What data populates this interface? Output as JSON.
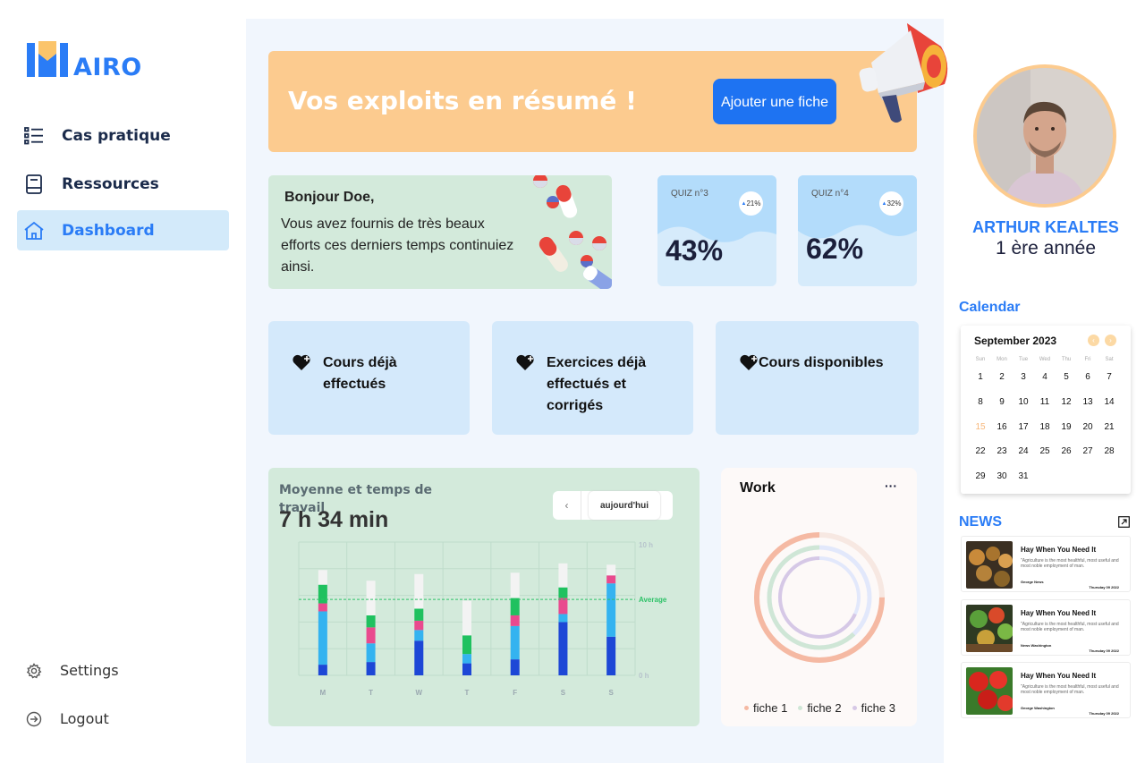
{
  "brand": {
    "name": "AIRO",
    "color": "#2a7cf6"
  },
  "nav": {
    "items": [
      {
        "label": "Cas pratique",
        "icon": "list-icon"
      },
      {
        "label": "Ressources",
        "icon": "book-icon"
      },
      {
        "label": "Dashboard",
        "icon": "home-icon",
        "active": true
      }
    ],
    "bottom": [
      {
        "label": "Settings",
        "icon": "gear-icon"
      },
      {
        "label": "Logout",
        "icon": "logout-icon"
      }
    ]
  },
  "banner": {
    "title": "Vos exploits en résumé  !",
    "button": "Ajouter une fiche"
  },
  "greeting": {
    "title": "Bonjour Doe,",
    "text": "Vous avez fournis de très beaux efforts ces derniers temps continuiez ainsi."
  },
  "quizzes": [
    {
      "label": "QUIZ n°3",
      "change": "21%",
      "value": "43%"
    },
    {
      "label": "QUIZ n°4",
      "change": "32%",
      "value": "62%"
    }
  ],
  "stats": [
    {
      "label": "Cours déjà effectués"
    },
    {
      "label": "Exercices déjà effectués et corrigés"
    },
    {
      "label": "Cours disponibles"
    }
  ],
  "work_chart": {
    "title": "Moyenne et temps de travail",
    "total": "7 h 34 min",
    "today_button": "aujourd'hui"
  },
  "chart_data": {
    "type": "bar",
    "stacked": true,
    "categories": [
      "M",
      "T",
      "W",
      "T",
      "F",
      "S",
      "S"
    ],
    "ylabels": [
      "10 h",
      "0 h"
    ],
    "ylim": [
      0,
      10
    ],
    "average_label": "Average",
    "average": 5.7,
    "colors": [
      "#1d47d6",
      "#34b3f0",
      "#e94a8e",
      "#1fc15f",
      "#f3f3f3"
    ],
    "series": [
      {
        "values": [
          0.8,
          4.0,
          0.6,
          1.4,
          1.1
        ]
      },
      {
        "values": [
          1.0,
          1.4,
          1.2,
          0.9,
          2.6
        ]
      },
      {
        "values": [
          2.6,
          0.8,
          0.7,
          0.9,
          2.6
        ]
      },
      {
        "values": [
          0.9,
          0.7,
          0.0,
          1.4,
          2.6
        ]
      },
      {
        "values": [
          1.2,
          2.5,
          0.8,
          1.3,
          1.9
        ]
      },
      {
        "values": [
          4.0,
          0.6,
          1.2,
          0.8,
          1.8
        ]
      },
      {
        "values": [
          2.9,
          4.0,
          0.6,
          0.0,
          0.8
        ]
      }
    ]
  },
  "work": {
    "title": "Work",
    "more": "···",
    "legend": [
      {
        "label": "fiche 1",
        "color": "#f5b9a3"
      },
      {
        "label": "fiche 2",
        "color": "#cfe6d6"
      },
      {
        "label": "fiche 3",
        "color": "#d6c8e6"
      }
    ],
    "rings": [
      {
        "progress": 0.75,
        "color": "#f5b9a3",
        "track": "#f7e8e2"
      },
      {
        "progress": 0.62,
        "color": "#cfe6d6",
        "track": "#e2e8fb"
      },
      {
        "progress": 0.68,
        "color": "#d6c8e6",
        "track": "#e2e8fb"
      }
    ]
  },
  "profile": {
    "name": "ARTHUR KEALTES",
    "year": "1 ère année"
  },
  "calendar": {
    "title": "Calendar",
    "month": "September 2023",
    "dow": [
      "Sun",
      "Mon",
      "Tue",
      "Wed",
      "Thu",
      "Fri",
      "Sat"
    ],
    "today": 15,
    "weeks": [
      [
        "1",
        "2",
        "3",
        "4",
        "5",
        "6",
        "7"
      ],
      [
        "8",
        "9",
        "10",
        "11",
        "12",
        "13",
        "14"
      ],
      [
        "15",
        "16",
        "17",
        "18",
        "19",
        "20",
        "21"
      ],
      [
        "22",
        "23",
        "24",
        "25",
        "26",
        "27",
        "28"
      ],
      [
        "29",
        "30",
        "31",
        "",
        "",
        "",
        ""
      ]
    ]
  },
  "news": {
    "title": "NEWS",
    "items": [
      {
        "headline": "Hay When You Need It",
        "excerpt": "\"Agriculture is the most healthful, most useful and most noble employment of man.",
        "author": "George News",
        "date": "Thursday 09 2022"
      },
      {
        "headline": "Hay When You Need It",
        "excerpt": "\"Agriculture is the most healthful, most useful and most noble employment of man.",
        "author": "News Washington",
        "date": "Thursday 09 2022"
      },
      {
        "headline": "Hay When You Need It",
        "excerpt": "\"Agriculture is the most healthful, most useful and most noble employment of man.",
        "author": "George Washington",
        "date": "Thursday 09 2022"
      }
    ]
  }
}
